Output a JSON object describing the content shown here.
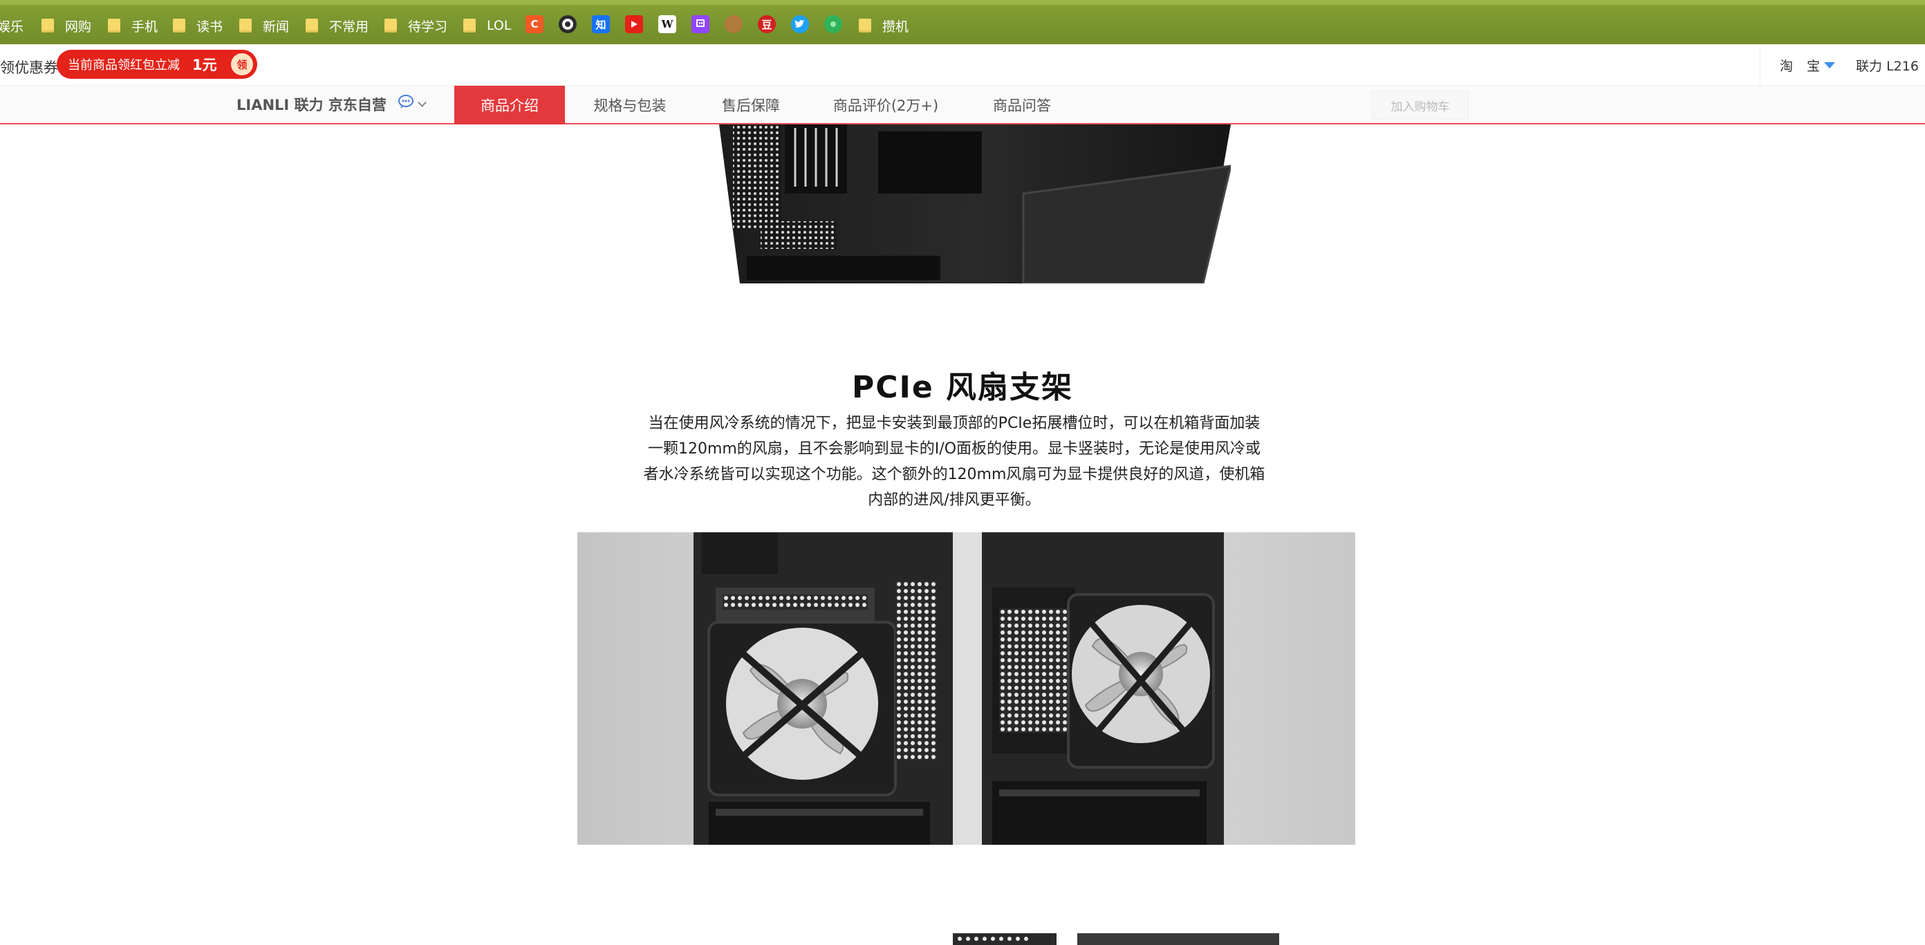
{
  "bookmarks": {
    "items": [
      {
        "label": "娱乐"
      },
      {
        "label": "网购"
      },
      {
        "label": "手机"
      },
      {
        "label": "读书"
      },
      {
        "label": "新闻"
      },
      {
        "label": "不常用"
      },
      {
        "label": "待学习"
      },
      {
        "label": "LOL"
      },
      {
        "label": "攒机"
      }
    ],
    "site_icons": [
      "csdn-icon",
      "github-icon",
      "zhihu-icon",
      "youtube-icon",
      "wikipedia-icon",
      "twitch-icon",
      "squirrel-icon",
      "douban-icon",
      "twitter-icon",
      "chrome-store-icon"
    ],
    "bar_color": "#7d9830"
  },
  "coupon": {
    "left_text": "领优惠券",
    "pill_text": "当前商品领红包立减",
    "amount": "1元",
    "badge": "领",
    "accent": "#e4231a"
  },
  "top_right": {
    "taobao_1": "淘",
    "taobao_2": "宝",
    "search_text": "联力 L216"
  },
  "product_tabs": {
    "shop_name": "LIANLI 联力 京东自营",
    "tabs": [
      {
        "label": "商品介绍",
        "active": true
      },
      {
        "label": "规格与包装",
        "active": false
      },
      {
        "label": "售后保障",
        "active": false
      },
      {
        "label": "商品评价(2万+)",
        "active": false
      },
      {
        "label": "商品问答",
        "active": false
      }
    ],
    "cart_button": "加入购物车",
    "active_color": "#e4393c"
  },
  "section": {
    "title": "PCIe 风扇支架",
    "description_lines": [
      "当在使用风冷系统的情况下，把显卡安装到最顶部的PCIe拓展槽位时，可以在机箱背面加装",
      "一颗120mm的风扇，且不会影响到显卡的I/O面板的使用。显卡竖装时，无论是使用风冷或",
      "者水冷系统皆可以实现这个功能。这个额外的120mm风扇可为显卡提供良好的风道，使机箱",
      "内部的进风/排风更平衡。"
    ]
  }
}
